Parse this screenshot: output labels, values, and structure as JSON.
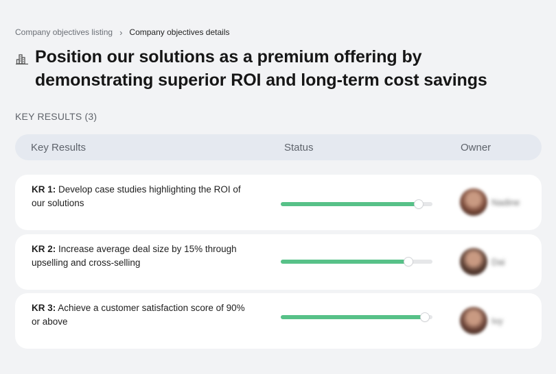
{
  "breadcrumb": {
    "parent": "Company objectives listing",
    "separator": "›",
    "current": "Company objectives details"
  },
  "objective": {
    "title": "Position our solutions as a premium offering by demonstrating superior ROI and long-term cost savings",
    "icon": "building-chart-icon"
  },
  "key_results_section": {
    "label": "KEY RESULTS (3)"
  },
  "table": {
    "headers": {
      "key_results": "Key Results",
      "status": "Status",
      "owner": "Owner"
    },
    "rows": [
      {
        "tag": "KR 1:",
        "text": "Develop case studies highlighting the ROI of our solutions",
        "progress": 0.91,
        "owner": {
          "name": "Nadine",
          "avatar_color": "#7a4a3a"
        }
      },
      {
        "tag": "KR 2:",
        "text": "Increase average deal size by 15% through upselling and cross-selling",
        "progress": 0.84,
        "owner": {
          "name": "Dai",
          "avatar_color": "#5b3e33"
        }
      },
      {
        "tag": "KR 3:",
        "text": "Achieve a customer satisfaction score of 90% or above",
        "progress": 0.95,
        "owner": {
          "name": "Ivy",
          "avatar_color": "#6b4438"
        }
      }
    ]
  },
  "colors": {
    "progress_fill": "#57c188",
    "progress_track": "#e6e7e9",
    "header_bg": "#e5e9f0",
    "page_bg": "#f2f3f5"
  }
}
